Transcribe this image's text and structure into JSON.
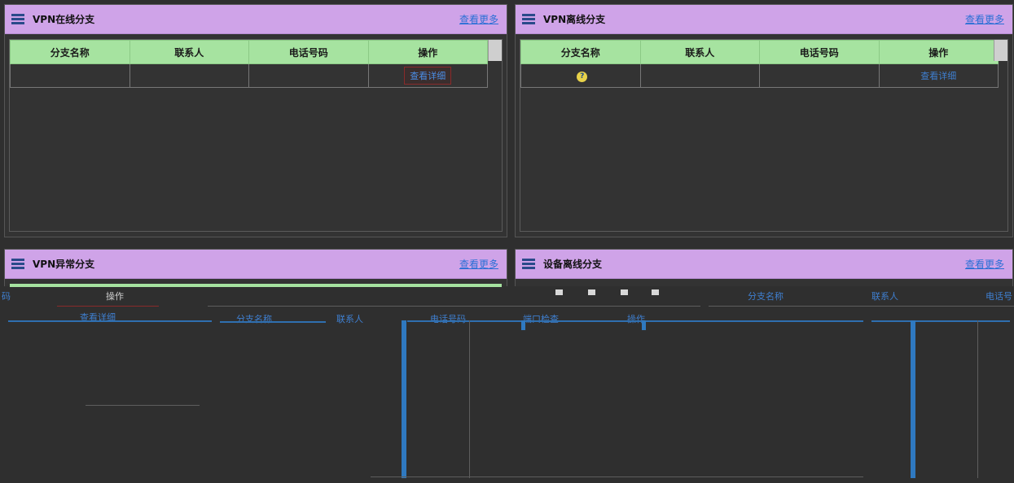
{
  "panels": {
    "vpn_online": {
      "title": "VPN在线分支",
      "more": "查看更多",
      "headers": [
        "分支名称",
        "联系人",
        "电话号码",
        "操作"
      ],
      "action": "查看详细"
    },
    "vpn_offline": {
      "title": "VPN离线分支",
      "more": "查看更多",
      "headers": [
        "分支名称",
        "联系人",
        "电话号码",
        "操作"
      ],
      "action": "查看详细"
    },
    "vpn_abnormal": {
      "title": "VPN异常分支",
      "more": "查看更多"
    },
    "device_offline": {
      "title": "设备离线分支",
      "more": "查看更多"
    }
  },
  "glitch": {
    "ma": "码",
    "op": "操作",
    "branch": "分支名称",
    "contact": "联系人",
    "phone": "电话号",
    "detail": "查看详细",
    "phone_num": "电话号码",
    "port": "端口检查",
    "op2": "操作",
    "branch2": "分支名称",
    "contact2": "联系人"
  },
  "colors": {
    "header_bg": "#cfa3e8",
    "table_header": "#a6e3a0",
    "link": "#2a6fd6",
    "bg": "#2f2f2f"
  }
}
